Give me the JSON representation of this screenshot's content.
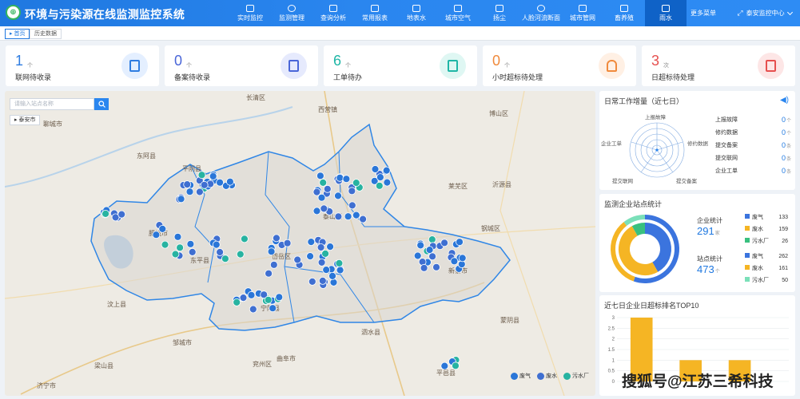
{
  "header": {
    "title": "环境与污染源在线监测监控系统",
    "nav": [
      {
        "label": "实时监控",
        "active": false
      },
      {
        "label": "监测管理",
        "active": false
      },
      {
        "label": "查询分析",
        "active": false
      },
      {
        "label": "常用报表",
        "active": false
      },
      {
        "label": "地表水",
        "active": false
      },
      {
        "label": "城市空气",
        "active": false
      },
      {
        "label": "扬尘",
        "active": false
      },
      {
        "label": "人脸河流断面",
        "active": false
      },
      {
        "label": "城市管网",
        "active": false
      },
      {
        "label": "畜养殖",
        "active": false
      },
      {
        "label": "雨水",
        "active": true
      }
    ],
    "more": "更多菜单",
    "center": "泰安监控中心"
  },
  "tabs": [
    "首页",
    "历史数据"
  ],
  "stats": [
    {
      "value": "1",
      "unit": "个",
      "label": "联网待收录",
      "color": "#2f7de1",
      "bg": "#e4efff"
    },
    {
      "value": "0",
      "unit": "个",
      "label": "备案待收录",
      "color": "#4a66d8",
      "bg": "#e6eafd"
    },
    {
      "value": "6",
      "unit": "个",
      "label": "工单待办",
      "color": "#1fb6a6",
      "bg": "#dff7f3"
    },
    {
      "value": "0",
      "unit": "个",
      "label": "小时超标待处理",
      "color": "#f08a3c",
      "bg": "#fff0e4"
    },
    {
      "value": "3",
      "unit": "次",
      "label": "日超标待处理",
      "color": "#e6504f",
      "bg": "#fde6e6"
    }
  ],
  "map": {
    "search_placeholder": "请输入站点名称",
    "city_tag": "泰安市",
    "place_labels": [
      "聊城市",
      "长清区",
      "西营镇",
      "莱芜区",
      "博山区",
      "平阴县",
      "东阿县",
      "东平县",
      "肥城市",
      "岱岳区",
      "泰山区",
      "新泰市",
      "宁阳县",
      "汶上县",
      "梁山县",
      "曲阜市",
      "泗水县",
      "平邑县",
      "蒙阴县",
      "沂源县",
      "钢城区",
      "济宁市",
      "兖州区",
      "邹城市"
    ],
    "legend": [
      "废气",
      "废水",
      "污水厂"
    ],
    "colors": {
      "gas": "#2a76d8",
      "water": "#3f6fd1",
      "plant": "#27b3a1"
    }
  },
  "work_panel": {
    "title": "日常工作增量（近七日）",
    "radar_labels": [
      "上报故障",
      "修约数据",
      "提交备案",
      "提交联网",
      "企业工单"
    ],
    "items": [
      {
        "label": "上报故障",
        "value": "0",
        "unit": "个"
      },
      {
        "label": "修约数据",
        "value": "0",
        "unit": "个"
      },
      {
        "label": "提交备案",
        "value": "0",
        "unit": "条"
      },
      {
        "label": "提交联网",
        "value": "0",
        "unit": "条"
      },
      {
        "label": "企业工单",
        "value": "0",
        "unit": "条"
      }
    ]
  },
  "station_panel": {
    "title": "监测企业站点统计",
    "enterprise_label": "企业统计",
    "enterprise_value": "291",
    "enterprise_unit": "家",
    "station_label": "站点统计",
    "station_value": "473",
    "station_unit": "个",
    "enterprise_breakdown": [
      {
        "label": "废气",
        "value": "133",
        "color": "#3b74de"
      },
      {
        "label": "废水",
        "value": "159",
        "color": "#f5b524"
      },
      {
        "label": "污水厂",
        "value": "26",
        "color": "#39c07f"
      }
    ],
    "station_breakdown": [
      {
        "label": "废气",
        "value": "262",
        "color": "#3b74de"
      },
      {
        "label": "废水",
        "value": "161",
        "color": "#f5b524"
      },
      {
        "label": "污水厂",
        "value": "50",
        "color": "#7be0b9"
      }
    ]
  },
  "top10_panel": {
    "title": "近七日企业日超标排名TOP10"
  },
  "chart_data": {
    "type": "bar",
    "categories": [
      "",
      "",
      ""
    ],
    "values": [
      3,
      1,
      1
    ],
    "ylim": [
      0,
      3
    ],
    "yticks": [
      "0",
      "0.5",
      "1",
      "1.5",
      "2",
      "2.5",
      "3"
    ],
    "color": "#f5b524"
  },
  "watermark": "搜狐号@江苏三希科技"
}
